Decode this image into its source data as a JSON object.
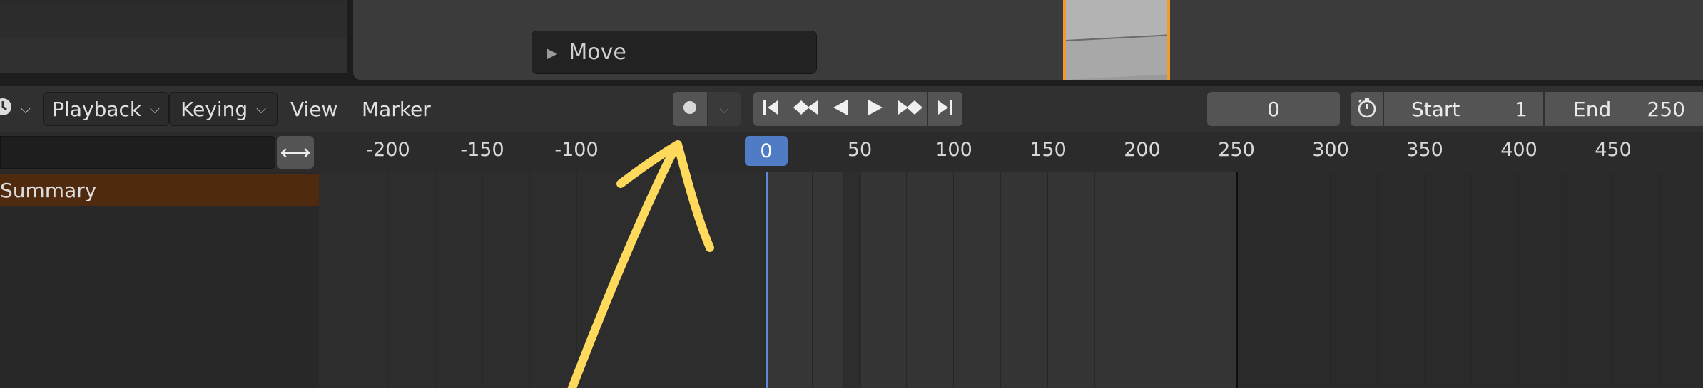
{
  "viewport": {
    "operator_panel_label": "Move"
  },
  "header": {
    "editor_type_icon": "clock-icon",
    "menus": {
      "playback": "Playback",
      "keying": "Keying",
      "view": "View",
      "marker": "Marker"
    },
    "transport": {
      "record_icon": "record-icon",
      "jump_start_icon": "jump-to-start-icon",
      "prev_keyframe_icon": "prev-keyframe-icon",
      "play_reverse_icon": "play-reverse-icon",
      "play_icon": "play-icon",
      "next_keyframe_icon": "next-keyframe-icon",
      "jump_end_icon": "jump-to-end-icon"
    },
    "current_frame": "0",
    "preview_range_icon": "stopwatch-icon",
    "start_label": "Start",
    "start_value": "1",
    "end_label": "End",
    "end_value": "250"
  },
  "ruler": {
    "search_placeholder": "",
    "swap_icon": "swap-arrows-icon",
    "current_frame_marker": "0",
    "ticks": [
      "-200",
      "-150",
      "-100",
      "50",
      "100",
      "150",
      "200",
      "250",
      "300",
      "350",
      "400",
      "450"
    ]
  },
  "channels": {
    "summary_label": "Summary"
  },
  "colors": {
    "accent_orange": "#f29a2e",
    "playhead_blue": "#5b8ad6",
    "summary_bg": "#4f2a0f",
    "annotation_yellow": "#ffd95c"
  }
}
